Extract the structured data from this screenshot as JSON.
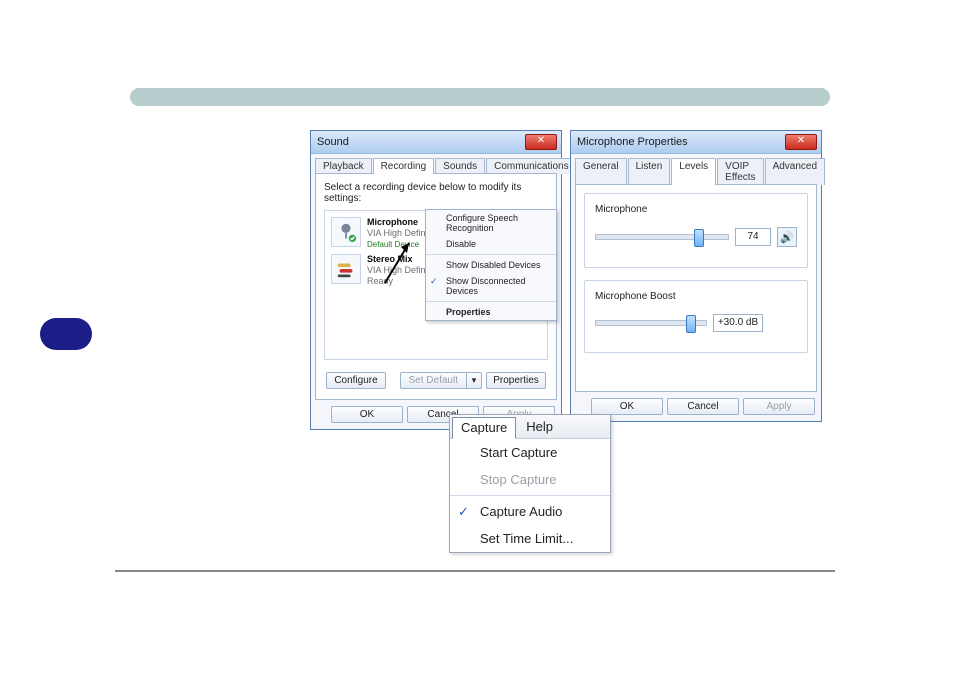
{
  "sound_dialog": {
    "title": "Sound",
    "close_glyph": "✕",
    "tabs": [
      "Playback",
      "Recording",
      "Sounds",
      "Communications"
    ],
    "active_tab_index": 1,
    "instruction": "Select a recording device below to modify its settings:",
    "devices": [
      {
        "name": "Microphone",
        "subtitle": "VIA High Definition Audio",
        "status": "Default Device"
      },
      {
        "name": "Stereo Mix",
        "subtitle": "VIA High Definition Audio",
        "status": "Ready"
      }
    ],
    "context_menu": {
      "items": [
        {
          "label": "Configure Speech Recognition",
          "checked": false,
          "bold": false
        },
        {
          "label": "Disable",
          "checked": false,
          "bold": false
        },
        {
          "sep": true
        },
        {
          "label": "Show Disabled Devices",
          "checked": false,
          "bold": false
        },
        {
          "label": "Show Disconnected Devices",
          "checked": true,
          "bold": false
        },
        {
          "sep": true
        },
        {
          "label": "Properties",
          "checked": false,
          "bold": true
        }
      ]
    },
    "buttons": {
      "configure": "Configure",
      "set_default": "Set Default",
      "properties": "Properties",
      "ok": "OK",
      "cancel": "Cancel",
      "apply": "Apply"
    }
  },
  "mic_dialog": {
    "title": "Microphone Properties",
    "close_glyph": "✕",
    "tabs": [
      "General",
      "Listen",
      "Levels",
      "VOIP Effects",
      "Advanced"
    ],
    "active_tab_index": 2,
    "mic_section": {
      "label": "Microphone",
      "value": "74",
      "slider_percent": 74
    },
    "boost_section": {
      "label": "Microphone Boost",
      "value": "+30.0 dB",
      "slider_percent": 82
    },
    "buttons": {
      "ok": "OK",
      "cancel": "Cancel",
      "apply": "Apply"
    }
  },
  "capture_menu": {
    "header": [
      "Capture",
      "Help"
    ],
    "items": [
      {
        "label": "Start Capture",
        "checked": false,
        "disabled": false
      },
      {
        "label": "Stop Capture",
        "checked": false,
        "disabled": true
      },
      {
        "sep": true
      },
      {
        "label": "Capture Audio",
        "checked": true,
        "disabled": false
      },
      {
        "label": "Set Time Limit...",
        "checked": false,
        "disabled": false
      }
    ]
  },
  "icons": {
    "speaker": "🔊",
    "check": "✓",
    "dropdown": "▾"
  }
}
